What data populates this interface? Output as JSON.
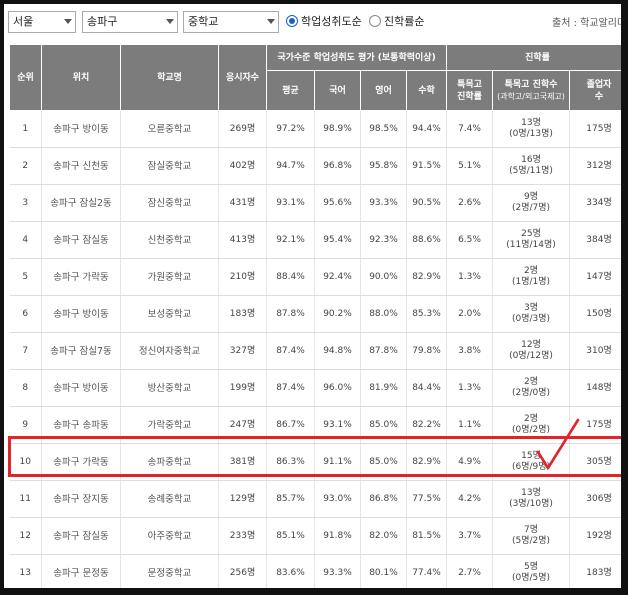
{
  "filters": {
    "region": "서울",
    "district": "송파구",
    "school_level": "중학교",
    "radio_achievement": "학업성취도순",
    "radio_advancement": "진학률순",
    "source": "출처 : 학교알리미"
  },
  "table": {
    "headers": {
      "rank": "순위",
      "location": "위치",
      "school": "학교명",
      "examinees": "응시자수",
      "national_group": "국가수준 학업성취도 평가 (보통학력이상)",
      "avg": "평균",
      "korean": "국어",
      "english": "영어",
      "math": "수학",
      "advancement_group": "진학률",
      "special_rate_l1": "특목고",
      "special_rate_l2": "진학률",
      "special_count_l1": "특목고 진학수",
      "special_count_l2": "(과학고/외고국제고)",
      "graduates_l1": "졸업자",
      "graduates_l2": "수"
    },
    "rows": [
      {
        "rank": "1",
        "location": "송파구 방이동",
        "school": "오륜중학교",
        "examinees": "269명",
        "avg": "97.2%",
        "korean": "98.9%",
        "english": "98.5%",
        "math": "94.4%",
        "special_rate": "7.4%",
        "special_count": "13명",
        "special_detail": "(0명/13명)",
        "graduates": "175명"
      },
      {
        "rank": "2",
        "location": "송파구 신천동",
        "school": "잠실중학교",
        "examinees": "402명",
        "avg": "94.7%",
        "korean": "96.8%",
        "english": "95.8%",
        "math": "91.5%",
        "special_rate": "5.1%",
        "special_count": "16명",
        "special_detail": "(5명/11명)",
        "graduates": "312명"
      },
      {
        "rank": "3",
        "location": "송파구 잠실2동",
        "school": "잠신중학교",
        "examinees": "431명",
        "avg": "93.1%",
        "korean": "95.6%",
        "english": "93.3%",
        "math": "90.5%",
        "special_rate": "2.6%",
        "special_count": "9명",
        "special_detail": "(2명/7명)",
        "graduates": "334명"
      },
      {
        "rank": "4",
        "location": "송파구 잠실동",
        "school": "신천중학교",
        "examinees": "413명",
        "avg": "92.1%",
        "korean": "95.4%",
        "english": "92.3%",
        "math": "88.6%",
        "special_rate": "6.5%",
        "special_count": "25명",
        "special_detail": "(11명/14명)",
        "graduates": "384명"
      },
      {
        "rank": "5",
        "location": "송파구 가락동",
        "school": "가원중학교",
        "examinees": "210명",
        "avg": "88.4%",
        "korean": "92.4%",
        "english": "90.0%",
        "math": "82.9%",
        "special_rate": "1.3%",
        "special_count": "2명",
        "special_detail": "(1명/1명)",
        "graduates": "147명"
      },
      {
        "rank": "6",
        "location": "송파구 방이동",
        "school": "보성중학교",
        "examinees": "183명",
        "avg": "87.8%",
        "korean": "90.2%",
        "english": "88.0%",
        "math": "85.3%",
        "special_rate": "2.0%",
        "special_count": "3명",
        "special_detail": "(0명/3명)",
        "graduates": "150명"
      },
      {
        "rank": "7",
        "location": "송파구 잠실7동",
        "school": "정신여자중학교",
        "examinees": "327명",
        "avg": "87.4%",
        "korean": "94.8%",
        "english": "87.8%",
        "math": "79.8%",
        "special_rate": "3.8%",
        "special_count": "12명",
        "special_detail": "(0명/12명)",
        "graduates": "310명"
      },
      {
        "rank": "8",
        "location": "송파구 방이동",
        "school": "방산중학교",
        "examinees": "199명",
        "avg": "87.4%",
        "korean": "96.0%",
        "english": "81.9%",
        "math": "84.4%",
        "special_rate": "1.3%",
        "special_count": "2명",
        "special_detail": "(2명/0명)",
        "graduates": "148명"
      },
      {
        "rank": "9",
        "location": "송파구 송파동",
        "school": "가락중학교",
        "examinees": "247명",
        "avg": "86.7%",
        "korean": "93.1%",
        "english": "85.0%",
        "math": "82.2%",
        "special_rate": "1.1%",
        "special_count": "2명",
        "special_detail": "(0명/2명)",
        "graduates": "175명"
      },
      {
        "rank": "10",
        "location": "송파구 가락동",
        "school": "송파중학교",
        "examinees": "381명",
        "avg": "86.3%",
        "korean": "91.1%",
        "english": "85.0%",
        "math": "82.9%",
        "special_rate": "4.9%",
        "special_count": "15명",
        "special_detail": "(6명/9명)",
        "graduates": "305명"
      },
      {
        "rank": "11",
        "location": "송파구 장지동",
        "school": "송례중학교",
        "examinees": "129명",
        "avg": "85.7%",
        "korean": "93.0%",
        "english": "86.8%",
        "math": "77.5%",
        "special_rate": "4.2%",
        "special_count": "13명",
        "special_detail": "(3명/10명)",
        "graduates": "306명"
      },
      {
        "rank": "12",
        "location": "송파구 잠실동",
        "school": "아주중학교",
        "examinees": "233명",
        "avg": "85.1%",
        "korean": "91.8%",
        "english": "82.0%",
        "math": "81.5%",
        "special_rate": "3.7%",
        "special_count": "7명",
        "special_detail": "(5명/2명)",
        "graduates": "192명"
      },
      {
        "rank": "13",
        "location": "송파구 문정동",
        "school": "문정중학교",
        "examinees": "256명",
        "avg": "83.6%",
        "korean": "93.3%",
        "english": "80.1%",
        "math": "77.4%",
        "special_rate": "2.7%",
        "special_count": "5명",
        "special_detail": "(0명/5명)",
        "graduates": "183명"
      }
    ]
  },
  "highlight": {
    "row_rank": "10",
    "color": "#e0242a"
  },
  "icons": {
    "radio_selected": "radio-selected-icon",
    "radio_unselected": "radio-unselected-icon",
    "dropdown": "chevron-down-icon",
    "annotation": "checkmark-icon"
  }
}
